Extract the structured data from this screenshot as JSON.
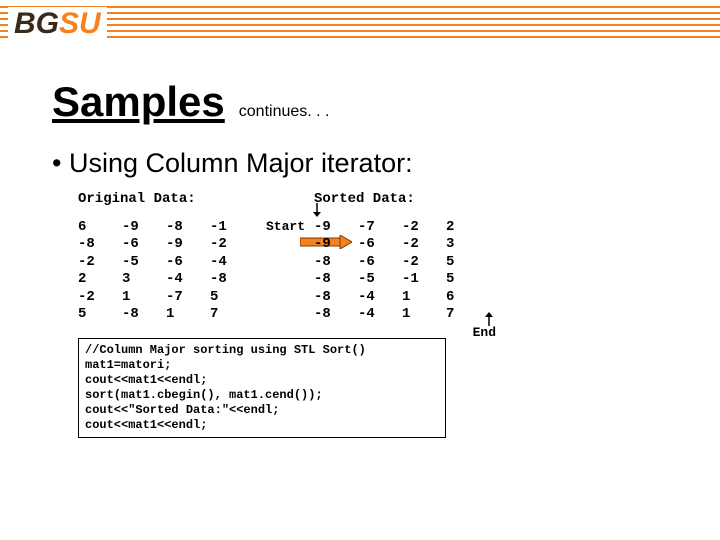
{
  "banner": {
    "logo_left": "BG",
    "logo_right": "SU"
  },
  "title": "Samples",
  "subtitle": "continues. . .",
  "bullet": "Using Column Major iterator:",
  "labels": {
    "original": "Original Data:",
    "sorted": "Sorted Data:",
    "start": "Start",
    "end": "End"
  },
  "original": {
    "c0": [
      "6",
      "-8",
      "-2",
      "2",
      "-2",
      "5"
    ],
    "c1": [
      "-9",
      "-6",
      "-5",
      "3",
      "1",
      "-8"
    ],
    "c2": [
      "-8",
      "-9",
      "-6",
      "-4",
      "-7",
      "1"
    ],
    "c3": [
      "-1",
      "-2",
      "-4",
      "-8",
      "5",
      "7"
    ]
  },
  "sorted": {
    "c0": [
      "-9",
      "-9",
      "-8",
      "-8",
      "-8",
      "-8"
    ],
    "c1": [
      "-7",
      "-6",
      "-6",
      "-5",
      "-4",
      "-4"
    ],
    "c2": [
      "-2",
      "-2",
      "-2",
      "-1",
      "1",
      "1"
    ],
    "c3": [
      "2",
      "3",
      "5",
      "5",
      "6",
      "7"
    ]
  },
  "code": "//Column Major sorting using STL Sort()\nmat1=matori;\ncout<<mat1<<endl;\nsort(mat1.cbegin(), mat1.cend());\ncout<<\"Sorted Data:\"<<endl;\ncout<<mat1<<endl;"
}
